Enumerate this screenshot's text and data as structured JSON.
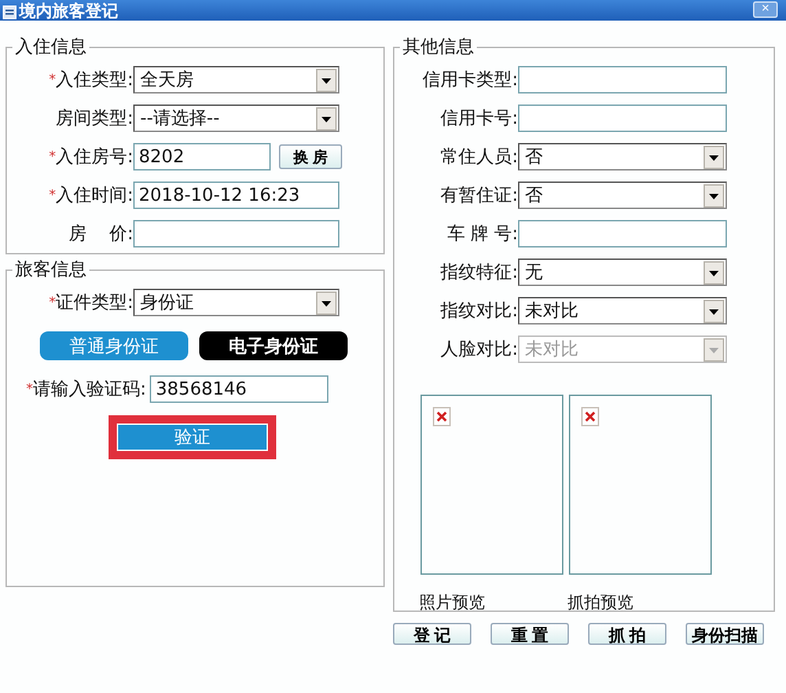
{
  "window": {
    "title": "境内旅客登记",
    "close": "×"
  },
  "checkin": {
    "legend": "入住信息",
    "rows": [
      {
        "label": "入住类型:",
        "required": "*",
        "kind": "select",
        "value": "全天房"
      },
      {
        "label": "房间类型:",
        "kind": "select",
        "value": "--请选择--"
      },
      {
        "label": "入住房号:",
        "required": "*",
        "kind": "text",
        "value": "8202",
        "button": "换 房"
      },
      {
        "label": "入住时间:",
        "required": "*",
        "kind": "text",
        "value": "2018-10-12 16:23"
      },
      {
        "label": "房    价:",
        "kind": "text",
        "value": ""
      }
    ]
  },
  "guest": {
    "legend": "旅客信息",
    "id_type": {
      "label": "证件类型:",
      "required": "*",
      "value": "身份证"
    },
    "id_tabs": [
      {
        "label": "普通身份证",
        "selected": true
      },
      {
        "label": "电子身份证",
        "selected": false
      }
    ],
    "code": {
      "label": "请输入验证码:",
      "required": "*",
      "value": "38568146"
    },
    "verify": {
      "label": "验证",
      "highlighted": true
    }
  },
  "other": {
    "legend": "其他信息",
    "rows": [
      {
        "label": "信用卡类型:",
        "kind": "text",
        "value": ""
      },
      {
        "label": "信用卡号:",
        "kind": "text",
        "value": ""
      },
      {
        "label": "常住人员:",
        "kind": "select",
        "value": "否"
      },
      {
        "label": "有暂住证:",
        "kind": "select",
        "value": "否"
      },
      {
        "label": "车 牌 号:",
        "kind": "text",
        "value": ""
      },
      {
        "label": "指纹特征:",
        "kind": "select",
        "value": "无"
      },
      {
        "label": "指纹对比:",
        "kind": "select",
        "value": "未对比"
      },
      {
        "label": "人脸对比:",
        "kind": "select",
        "value": "未对比",
        "disabled": true
      }
    ],
    "previews": [
      {
        "caption": "照片预览"
      },
      {
        "caption": "抓拍预览"
      }
    ]
  },
  "buttons": [
    "登 记",
    "重 置",
    "抓 拍",
    "身份扫描"
  ]
}
